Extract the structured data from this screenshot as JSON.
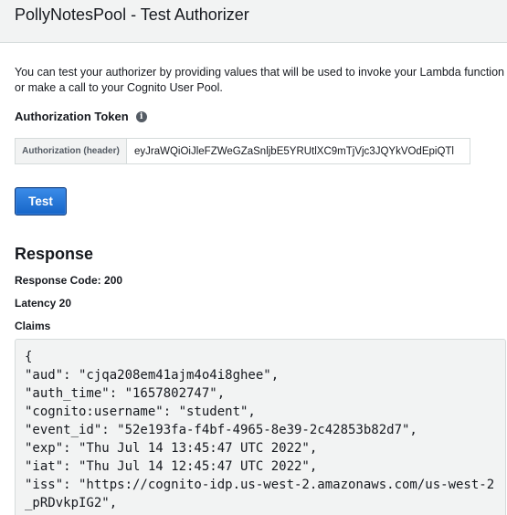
{
  "header": {
    "title": "PollyNotesPool - Test Authorizer"
  },
  "description": "You can test your authorizer by providing values that will be used to invoke your Lambda function or make a call to your Cognito User Pool.",
  "auth": {
    "label": "Authorization Token",
    "info_icon": "i",
    "addon_label": "Authorization (header)",
    "token_value": "eyJraWQiOiJleFZWeGZaSnljbE5YRUtlXC9mTjVjc3JQYkVOdEpiQTl"
  },
  "test_button": {
    "label": "Test"
  },
  "response": {
    "heading": "Response",
    "code": "Response Code: 200",
    "latency": "Latency 20",
    "claims_label": "Claims",
    "claims_lines": [
      "{",
      "\"aud\": \"cjqa208em41ajm4o4i8ghee\",",
      "\"auth_time\": \"1657802747\",",
      "\"cognito:username\": \"student\",",
      "\"event_id\": \"52e193fa-f4bf-4965-8e39-2c42853b82d7\",",
      "\"exp\": \"Thu Jul 14 13:45:47 UTC 2022\",",
      "\"iat\": \"Thu Jul 14 12:45:47 UTC 2022\",",
      "\"iss\": \"https://cognito-idp.us-west-2.amazonaws.com/us-west-2",
      "_pRDvkpIG2\","
    ]
  }
}
